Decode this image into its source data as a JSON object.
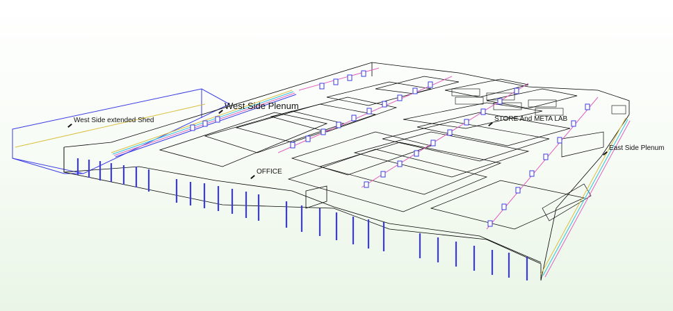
{
  "labels": {
    "west_shed": "West Side extended Shed",
    "west_plenum": "West Side Plenum",
    "office": "OFFICE",
    "store_meta": "STORE And META LAB",
    "east_plenum": "East Side Plenum"
  },
  "colors": {
    "background_top": "#ffffff",
    "background_bottom": "#e9f5e6",
    "outline": "#000000",
    "shed_blue": "#3a3ae6",
    "duct_yellow": "#d9c040",
    "duct_pink": "#e060c0",
    "duct_cyan": "#30c0e0"
  }
}
